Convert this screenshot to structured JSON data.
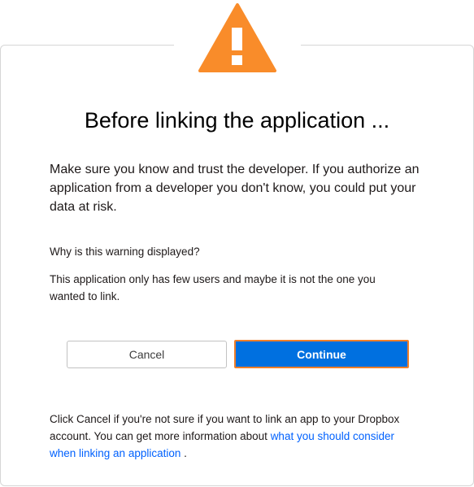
{
  "dialog": {
    "title": "Before linking the application ...",
    "intro": "Make sure you know and trust the developer. If you authorize an application from a developer you don't know, you could put your data at risk.",
    "why_heading": "Why is this warning displayed?",
    "why_text": "This application only has few users and maybe it is not the one you wanted to link."
  },
  "buttons": {
    "cancel_label": "Cancel",
    "continue_label": "Continue"
  },
  "footer": {
    "text_before_link": "Click Cancel if you're not sure if you want to link an app to your Dropbox account. You can get more information about ",
    "link_text": "what you should consider when linking an application",
    "text_after_link": " ."
  },
  "icons": {
    "warning": "warning-triangle-icon"
  },
  "colors": {
    "warning_orange": "#f98c2a",
    "primary_blue": "#0070e0",
    "focus_outline": "#f07f29",
    "link_blue": "#0061fe"
  }
}
